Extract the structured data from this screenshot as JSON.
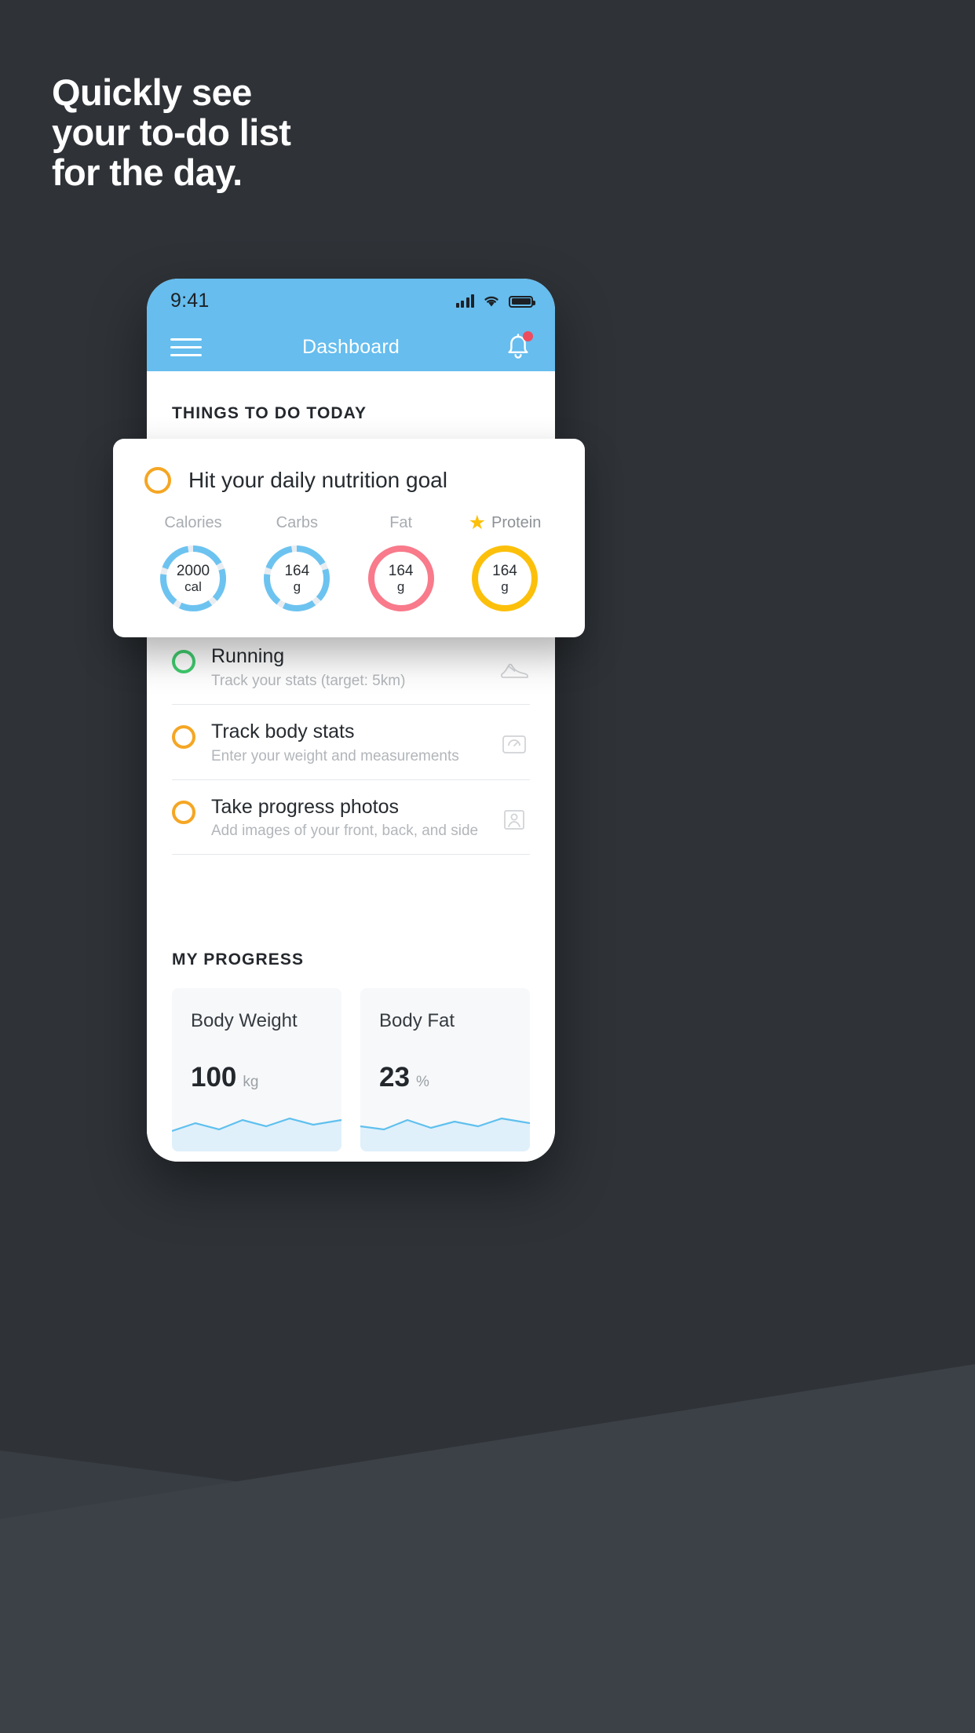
{
  "headline": "Quickly see\nyour to-do list\nfor the day.",
  "colors": {
    "background": "#2f3338",
    "accent_blue": "#66bdee",
    "amber": "#f5a623",
    "yellow": "#fcc00b",
    "green": "#3fcc6e",
    "red": "#f87a8b",
    "notification_dot": "#ee4d5f"
  },
  "phone": {
    "status_bar": {
      "time": "9:41",
      "icons": [
        "signal-icon",
        "wifi-icon",
        "battery-icon"
      ]
    },
    "nav": {
      "menu_icon": "hamburger-menu-icon",
      "title": "Dashboard",
      "bell_icon": "notification-bell-icon",
      "has_badge": true
    },
    "sections": {
      "todo_label": "THINGS TO DO TODAY",
      "progress_label": "MY PROGRESS"
    },
    "todos": [
      {
        "title": "Running",
        "subtitle": "Track your stats (target: 5km)",
        "ring_color": "green",
        "icon": "running-shoe-icon"
      },
      {
        "title": "Track body stats",
        "subtitle": "Enter your weight and measurements",
        "ring_color": "amber",
        "icon": "weight-scale-icon"
      },
      {
        "title": "Take progress photos",
        "subtitle": "Add images of your front, back, and side",
        "ring_color": "amber",
        "icon": "photo-portrait-icon"
      }
    ],
    "progress_cards": [
      {
        "title": "Body Weight",
        "value": "100",
        "unit": "kg"
      },
      {
        "title": "Body Fat",
        "value": "23",
        "unit": "%"
      }
    ]
  },
  "nutrition_card": {
    "ring_color": "amber",
    "title": "Hit your daily nutrition goal",
    "macros": [
      {
        "label": "Calories",
        "value": "2000",
        "unit": "cal",
        "color": "#6dc3f0",
        "starred": false,
        "percent": 72
      },
      {
        "label": "Carbs",
        "value": "164",
        "unit": "g",
        "color": "#6dc3f0",
        "starred": false,
        "percent": 72
      },
      {
        "label": "Fat",
        "value": "164",
        "unit": "g",
        "color": "#f87a8b",
        "starred": false,
        "percent": 100
      },
      {
        "label": "Protein",
        "value": "164",
        "unit": "g",
        "color": "#fcc00b",
        "starred": true,
        "percent": 100
      }
    ],
    "star_icon": "star-icon"
  }
}
